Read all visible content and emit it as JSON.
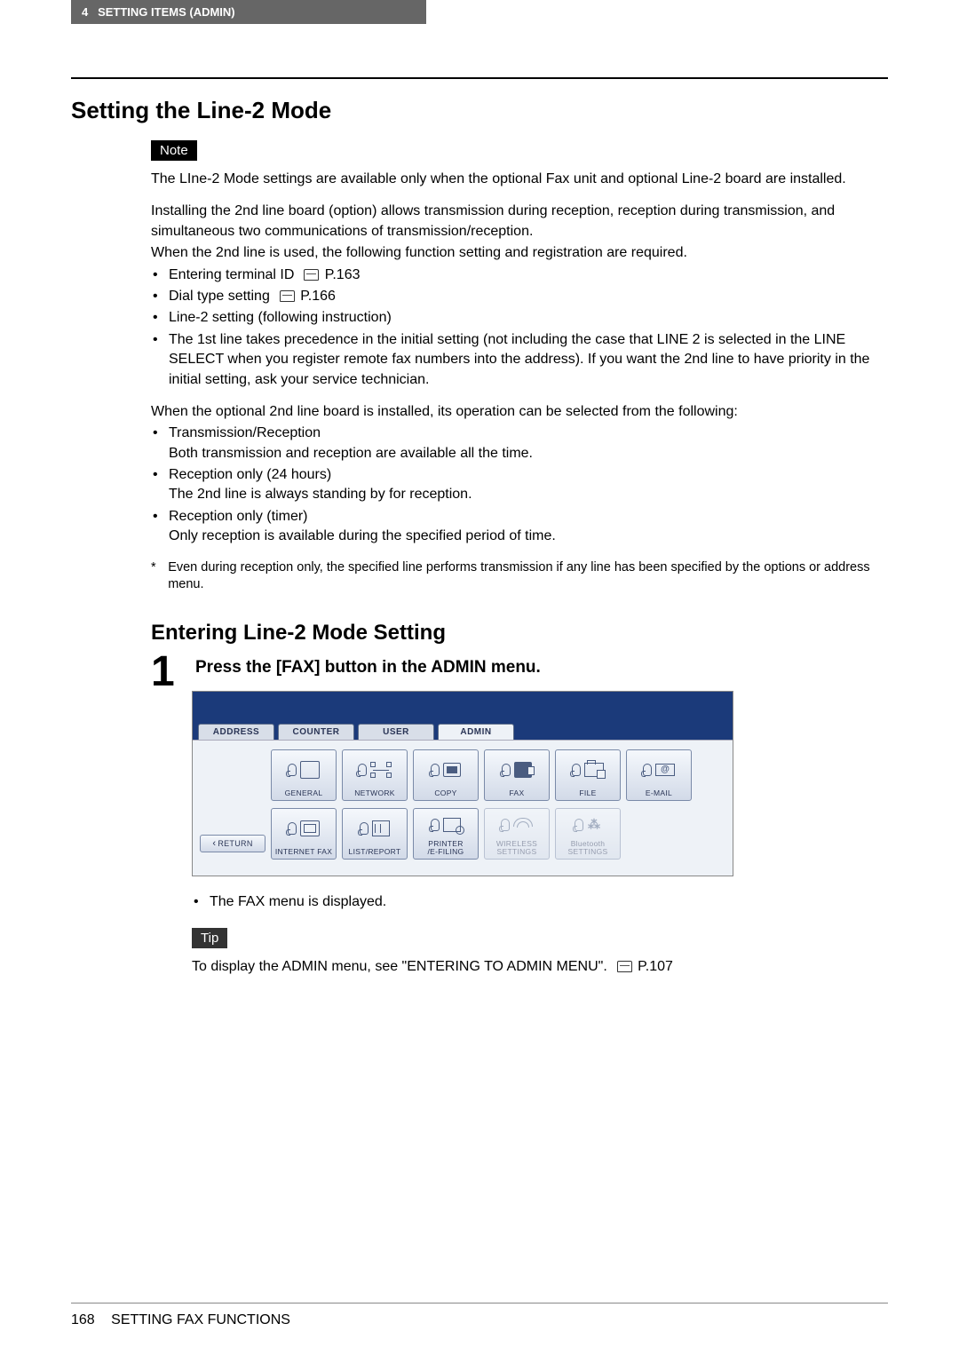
{
  "header": {
    "chapter": "4",
    "title": "SETTING ITEMS (ADMIN)"
  },
  "section_title": "Setting the Line-2 Mode",
  "note_label": "Note",
  "note_text": "The LIne-2 Mode settings are available only when the optional Fax unit and optional Line-2 board are installed.",
  "intro_para": "Installing the 2nd line board (option) allows transmission during reception, reception during transmission, and simultaneous two communications of transmission/reception.",
  "intro_line2": "When the 2nd line is used, the following function setting and registration are required.",
  "req_list": [
    {
      "text": "Entering terminal ID",
      "ref": "P.163"
    },
    {
      "text": "Dial type setting",
      "ref": "P.166"
    },
    {
      "text": "Line-2 setting (following instruction)",
      "ref": ""
    },
    {
      "text": "The 1st line takes precedence in the initial setting (not including the case that LINE 2 is selected in the LINE SELECT when you register remote fax numbers into the address). If you want the 2nd line to have priority in the initial setting, ask your service technician.",
      "ref": ""
    }
  ],
  "ops_intro": "When the optional 2nd line board is installed, its operation can be selected from the following:",
  "ops_list": [
    {
      "title": "Transmission/Reception",
      "desc": "Both transmission and reception are available all the time."
    },
    {
      "title": "Reception only (24 hours)",
      "desc": "The 2nd line is always standing by for reception."
    },
    {
      "title": "Reception only (timer)",
      "desc": "Only reception is available during the specified period of time."
    }
  ],
  "asterisk_note": "Even during reception only, the specified line performs transmission if any line has been specified by the options or address menu.",
  "subheading": "Entering Line-2 Mode Setting",
  "step": {
    "num": "1",
    "title": "Press the [FAX] button in the ADMIN menu."
  },
  "panel": {
    "tabs": [
      "ADDRESS",
      "COUNTER",
      "USER",
      "ADMIN"
    ],
    "active_tab_index": 3,
    "return_label": "RETURN",
    "row1": [
      {
        "label": "GENERAL",
        "kind": "general"
      },
      {
        "label": "NETWORK",
        "kind": "network"
      },
      {
        "label": "COPY",
        "kind": "copy"
      },
      {
        "label": "FAX",
        "kind": "fax"
      },
      {
        "label": "FILE",
        "kind": "file"
      },
      {
        "label": "E-MAIL",
        "kind": "email"
      }
    ],
    "row2": [
      {
        "label": "INTERNET FAX",
        "kind": "ifax",
        "disabled": false
      },
      {
        "label": "LIST/REPORT",
        "kind": "list",
        "disabled": false
      },
      {
        "label": "PRINTER\n/E-FILING",
        "kind": "print",
        "disabled": false
      },
      {
        "label": "WIRELESS\nSETTINGS",
        "kind": "wifi",
        "disabled": true
      },
      {
        "label": "Bluetooth\nSETTINGS",
        "kind": "bt",
        "disabled": true
      }
    ]
  },
  "after_bullet": "The FAX menu is displayed.",
  "tip_label": "Tip",
  "tip_text": "To display the ADMIN menu, see \"ENTERING TO ADMIN MENU\".",
  "tip_ref": "P.107",
  "footer": {
    "page": "168",
    "title": "SETTING FAX FUNCTIONS"
  }
}
